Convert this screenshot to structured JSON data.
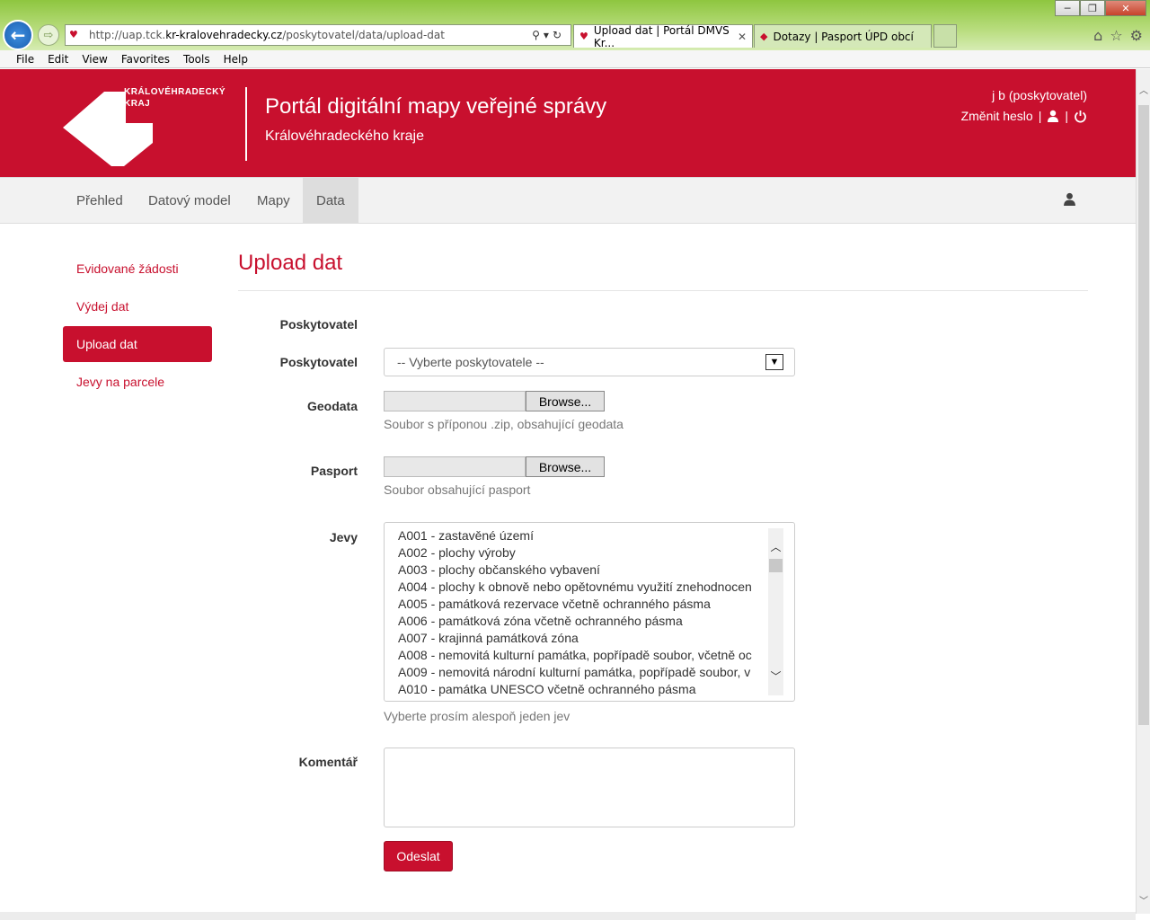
{
  "browser": {
    "url_prefix": "http://uap.tck.",
    "url_host": "kr-kralovehradecky.cz",
    "url_path": "/poskytovatel/data/upload-dat",
    "tabs": [
      {
        "label": "Upload dat | Portál DMVS Kr..."
      },
      {
        "label": "Dotazy | Pasport ÚPD obcí"
      }
    ],
    "menu": [
      "File",
      "Edit",
      "View",
      "Favorites",
      "Tools",
      "Help"
    ]
  },
  "header": {
    "logo_line1": "KRÁLOVÉHRADECKÝ",
    "logo_line2": "KRAJ",
    "title": "Portál digitální mapy veřejné správy",
    "subtitle": "Královéhradeckého kraje",
    "user": "j b (poskytovatel)",
    "change_password": "Změnit heslo",
    "separator": "|"
  },
  "nav": {
    "items": [
      "Přehled",
      "Datový model",
      "Mapy",
      "Data"
    ]
  },
  "sidebar": {
    "items": [
      "Evidované žádosti",
      "Výdej dat",
      "Upload dat",
      "Jevy na parcele"
    ]
  },
  "form": {
    "title": "Upload dat",
    "provider_heading": "Poskytovatel",
    "provider_label": "Poskytovatel",
    "provider_select": "-- Vyberte poskytovatele --",
    "geodata_label": "Geodata",
    "browse_label": "Browse...",
    "geodata_help": "Soubor s příponou .zip, obsahující geodata",
    "pasport_label": "Pasport",
    "pasport_help": "Soubor obsahující pasport",
    "jevy_label": "Jevy",
    "jevy_options": [
      "A001 - zastavěné území",
      "A002 - plochy výroby",
      "A003 - plochy občanského vybavení",
      "A004 - plochy k obnově nebo opětovnému využití znehodnocen",
      "A005 - památková rezervace včetně ochranného pásma",
      "A006 - památková zóna včetně ochranného pásma",
      "A007 - krajinná památková zóna",
      "A008 - nemovitá kulturní památka, popřípadě soubor, včetně oc",
      "A009 - nemovitá národní kulturní památka, popřípadě soubor, v",
      "A010 - památka UNESCO včetně ochranného pásma"
    ],
    "jevy_help": "Vyberte prosím alespoň jeden jev",
    "comment_label": "Komentář",
    "submit_label": "Odeslat"
  }
}
